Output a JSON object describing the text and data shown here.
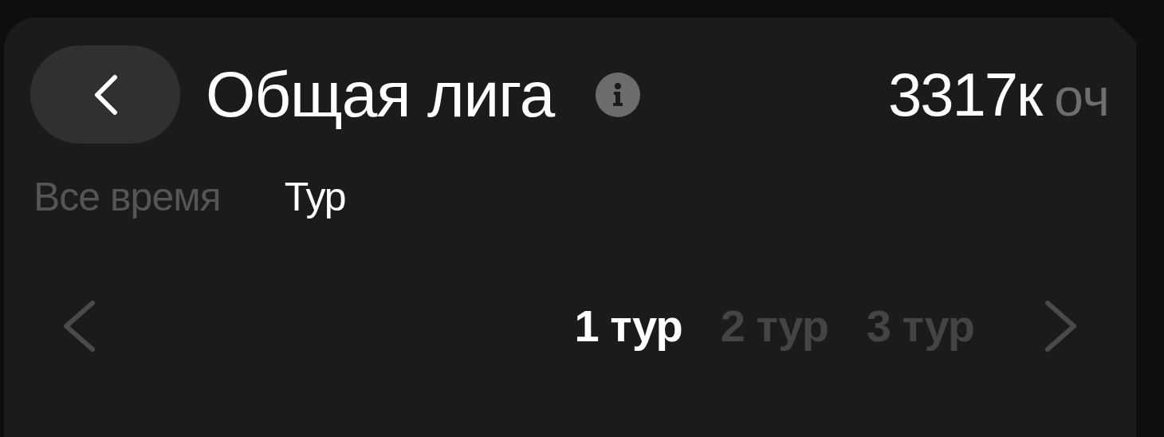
{
  "header": {
    "title": "Общая лига",
    "score": {
      "value": "3317к",
      "unit": "оч"
    }
  },
  "tabs": [
    {
      "label": "Все время",
      "selected": false
    },
    {
      "label": "Тур",
      "selected": true
    }
  ],
  "rounds": [
    {
      "label": "1 тур",
      "selected": true
    },
    {
      "label": "2 тур",
      "selected": false
    },
    {
      "label": "3 тур",
      "selected": false
    }
  ]
}
